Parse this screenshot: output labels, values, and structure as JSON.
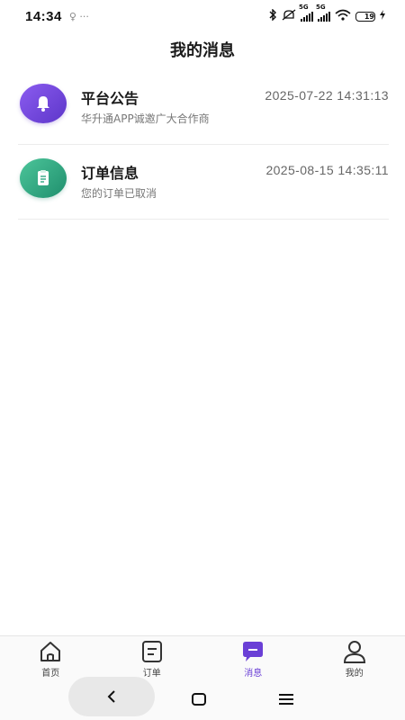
{
  "status_bar": {
    "time": "14:34",
    "left_extra": "♀ ···",
    "network_1": "5G",
    "network_2": "5G",
    "battery": "19"
  },
  "page": {
    "title": "我的消息"
  },
  "messages": [
    {
      "title": "平台公告",
      "time": "2025-07-22 14:31:13",
      "preview": "华升通APP诚邀广大合作商",
      "icon": "bell-icon",
      "color": "#6f45dc"
    },
    {
      "title": "订单信息",
      "time": "2025-08-15 14:35:11",
      "preview": "您的订单已取消",
      "icon": "document-icon",
      "color": "#2ea882"
    }
  ],
  "tabs": [
    {
      "label": "首页",
      "icon": "home-icon"
    },
    {
      "label": "订单",
      "icon": "order-icon"
    },
    {
      "label": "消息",
      "icon": "message-icon",
      "active": true
    },
    {
      "label": "我的",
      "icon": "profile-icon"
    }
  ],
  "system_nav": {
    "back": "back-icon",
    "home": "home-square-icon",
    "menu": "menu-icon"
  },
  "colors": {
    "accent": "#6a3fd6",
    "text": "#1a1a1a",
    "muted": "#777777"
  }
}
